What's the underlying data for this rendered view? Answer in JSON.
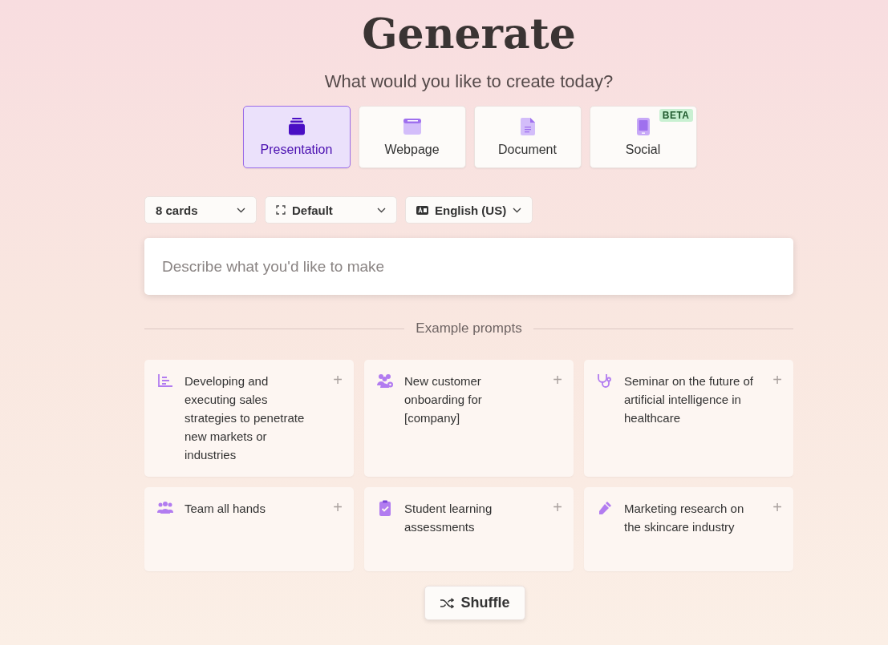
{
  "title": "Generate",
  "subtitle": "What would you like to create today?",
  "types": [
    {
      "label": "Presentation",
      "selected": true
    },
    {
      "label": "Webpage",
      "selected": false
    },
    {
      "label": "Document",
      "selected": false
    },
    {
      "label": "Social",
      "selected": false,
      "badge": "BETA"
    }
  ],
  "options": [
    {
      "value": "8 cards"
    },
    {
      "value": "Default"
    },
    {
      "value": "English (US)"
    }
  ],
  "prompt_field": {
    "placeholder": "Describe what you'd like to make"
  },
  "examples_heading": "Example prompts",
  "examples": [
    {
      "text": "Developing and executing sales strategies to penetrate new markets or industries",
      "add": "+"
    },
    {
      "text": "New customer onboarding for [company]",
      "add": "+"
    },
    {
      "text": "Seminar on the future of artificial intelligence in healthcare",
      "add": "+"
    },
    {
      "text": "Team all hands",
      "add": "+"
    },
    {
      "text": "Student learning assessments",
      "add": "+"
    },
    {
      "text": "Marketing research on the skincare industry",
      "add": "+"
    }
  ],
  "shuffle_button": "Shuffle"
}
